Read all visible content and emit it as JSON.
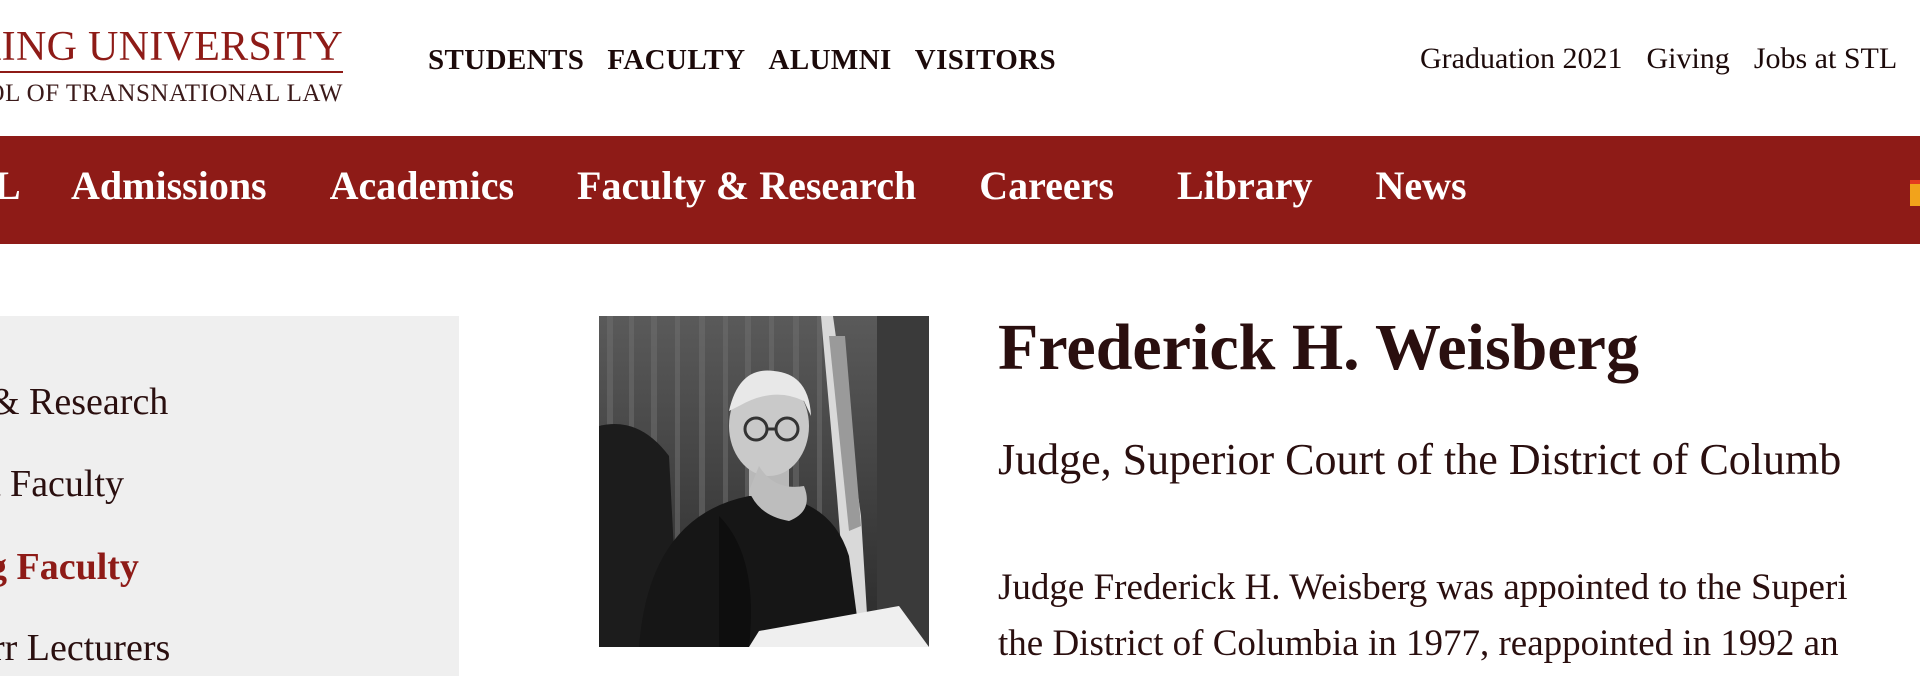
{
  "logo": {
    "line1": "KING UNIVERSITY",
    "line2": "OOL OF TRANSNATIONAL LAW"
  },
  "audience_nav": [
    "STUDENTS",
    "FACULTY",
    "ALUMNI",
    "VISITORS"
  ],
  "utility_nav": [
    "Graduation 2021",
    "Giving",
    "Jobs at STL"
  ],
  "main_nav": {
    "cut_label": "L",
    "items": [
      "Admissions",
      "Academics",
      "Faculty & Research",
      "Careers",
      "Library",
      "News"
    ]
  },
  "sidebar": {
    "items": [
      {
        "label": "& Research",
        "active": false
      },
      {
        "label": "t Faculty",
        "active": false
      },
      {
        "label": "g Faculty",
        "active": true
      },
      {
        "label": "rr Lecturers",
        "active": false
      }
    ]
  },
  "profile": {
    "name": "Frederick H. Weisberg",
    "title": "Judge, Superior Court of the District of Columb",
    "bio_line1": "Judge Frederick H. Weisberg was appointed to the Superi",
    "bio_line2": "the District of Columbia in 1977, reappointed in 1992 an"
  },
  "colors": {
    "brand": "#8e1b17",
    "text": "#2a0f0f",
    "sidebar_bg": "#efefef"
  }
}
